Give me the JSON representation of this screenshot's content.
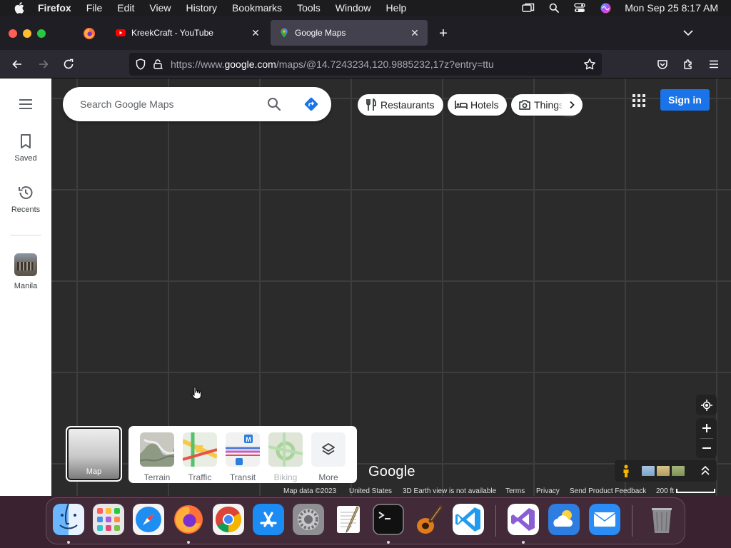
{
  "menubar": {
    "app_name": "Firefox",
    "items": [
      "File",
      "Edit",
      "View",
      "History",
      "Bookmarks",
      "Tools",
      "Window",
      "Help"
    ],
    "clock": "Mon Sep 25  8:17 AM"
  },
  "tabs": [
    {
      "title": "KreekCraft - YouTube",
      "favicon": "youtube-icon"
    },
    {
      "title": "Google Maps",
      "favicon": "google-maps-icon",
      "active": true
    }
  ],
  "urlbar": {
    "prefix": "https://www.",
    "domain": "google.com",
    "path": "/maps/@14.7243234,120.9885232,17z?entry=ttu"
  },
  "sidebar": {
    "saved_label": "Saved",
    "recents_label": "Recents",
    "recent_place": "Manila"
  },
  "search": {
    "placeholder": "Search Google Maps"
  },
  "chips": {
    "restaurants": "Restaurants",
    "hotels": "Hotels",
    "things": "Things"
  },
  "header": {
    "signin_label": "Sign in"
  },
  "layers": {
    "map_label": "Map",
    "terrain_label": "Terrain",
    "traffic_label": "Traffic",
    "transit_label": "Transit",
    "biking_label": "Biking",
    "more_label": "More"
  },
  "logo": {
    "text": "Google"
  },
  "attribution": {
    "map_data": "Map data ©2023",
    "country": "United States",
    "earth_note": "3D Earth view is not available",
    "terms": "Terms",
    "privacy": "Privacy",
    "feedback": "Send Product Feedback",
    "scale": "200 ft"
  },
  "colors": {
    "map_bg": "#2b2b2b",
    "signin_blue": "#1a73e8",
    "active_tab": "#42414d"
  },
  "dock": [
    "Finder",
    "Launchpad",
    "Safari",
    "Firefox",
    "Google Chrome",
    "App Store",
    "System Settings",
    "TextEdit",
    "Terminal",
    "GarageBand",
    "Visual Studio Code",
    "Visual Studio",
    "Weather",
    "Mail",
    "Trash"
  ]
}
